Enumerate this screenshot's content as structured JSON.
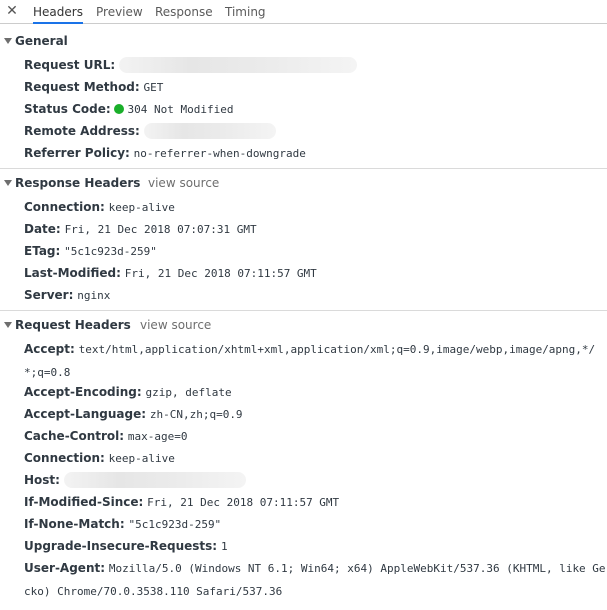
{
  "tabs": [
    {
      "label": "Headers"
    },
    {
      "label": "Preview"
    },
    {
      "label": "Response"
    },
    {
      "label": "Timing"
    }
  ],
  "close_icon": "close-icon",
  "general": {
    "title": "General",
    "request_url_label": "Request URL:",
    "request_method_label": "Request Method:",
    "request_method_value": "GET",
    "status_code_label": "Status Code:",
    "status_code_value": "304 Not Modified",
    "status_color": "#1aaf2a",
    "remote_address_label": "Remote Address:",
    "referrer_policy_label": "Referrer Policy:",
    "referrer_policy_value": "no-referrer-when-downgrade"
  },
  "response_headers": {
    "title": "Response Headers",
    "view_source": "view source",
    "items": [
      {
        "name": "Connection:",
        "value": "keep-alive"
      },
      {
        "name": "Date:",
        "value": "Fri, 21 Dec 2018 07:07:31 GMT"
      },
      {
        "name": "ETag:",
        "value": "\"5c1c923d-259\""
      },
      {
        "name": "Last-Modified:",
        "value": "Fri, 21 Dec 2018 07:11:57 GMT"
      },
      {
        "name": "Server:",
        "value": "nginx"
      }
    ]
  },
  "request_headers": {
    "title": "Request Headers",
    "view_source": "view source",
    "accept_name": "Accept:",
    "accept_value": "text/html,application/xhtml+xml,application/xml;q=0.9,image/webp,image/apng,*/*;q=0.8",
    "items": [
      {
        "name": "Accept-Encoding:",
        "value": "gzip, deflate"
      },
      {
        "name": "Accept-Language:",
        "value": "zh-CN,zh;q=0.9"
      },
      {
        "name": "Cache-Control:",
        "value": "max-age=0"
      },
      {
        "name": "Connection:",
        "value": "keep-alive"
      }
    ],
    "host_name": "Host:",
    "items2": [
      {
        "name": "If-Modified-Since:",
        "value": "Fri, 21 Dec 2018 07:11:57 GMT"
      },
      {
        "name": "If-None-Match:",
        "value": "\"5c1c923d-259\""
      },
      {
        "name": "Upgrade-Insecure-Requests:",
        "value": "1"
      }
    ],
    "user_agent_name": "User-Agent:",
    "user_agent_value": "Mozilla/5.0 (Windows NT 6.1; Win64; x64) AppleWebKit/537.36 (KHTML, like Gecko) Chrome/70.0.3538.110 Safari/537.36"
  }
}
